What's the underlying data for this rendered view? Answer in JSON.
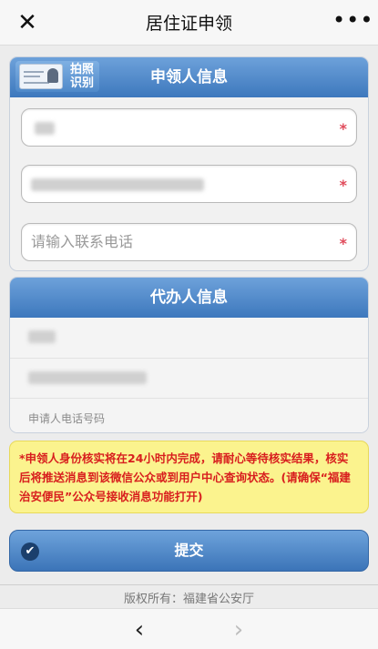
{
  "nav": {
    "title": "居住证申领",
    "close_icon": "close-icon",
    "more_icon": "more-icon"
  },
  "applicant": {
    "scan_label": "拍照识别",
    "title": "申领人信息",
    "phone_placeholder": "请输入联系电话",
    "required_mark": "*"
  },
  "agent": {
    "title": "代办人信息",
    "phone_placeholder": "申请人电话号码"
  },
  "notice": "*申领人身份核实将在24小时内完成，请耐心等待核实结果，核实后将推送消息到该微信公众或到用户中心查询状态。(请确保“福建治安便民”公众号接收消息功能打开)",
  "submit_label": "提交",
  "footer": "版权所有：福建省公安厅",
  "colors": {
    "header_blue": "#3d78bd",
    "notice_bg": "#fbf38e",
    "notice_text": "#d81e1e",
    "required_star": "#e04a5a"
  }
}
